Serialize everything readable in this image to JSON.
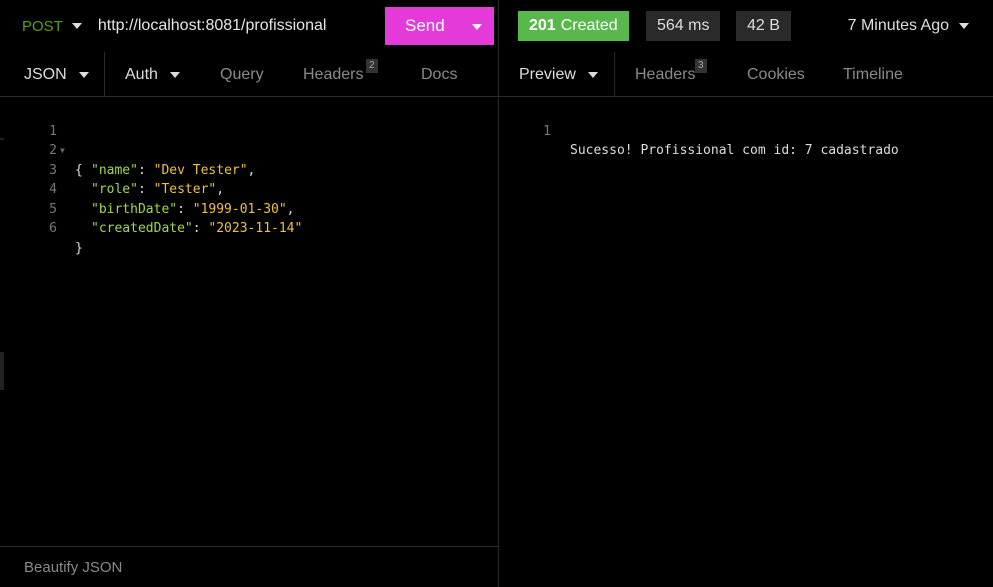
{
  "request": {
    "method": "POST",
    "url": "http://localhost:8081/profissional",
    "send_label": "Send"
  },
  "response": {
    "status_code": "201",
    "status_text": "Created",
    "time": "564 ms",
    "size": "42 B",
    "time_ago": "7 Minutes Ago"
  },
  "request_tabs": [
    {
      "label": "JSON"
    },
    {
      "label": "Auth"
    },
    {
      "label": "Query"
    },
    {
      "label": "Headers",
      "badge": "2"
    },
    {
      "label": "Docs"
    }
  ],
  "response_tabs": [
    {
      "label": "Preview"
    },
    {
      "label": "Headers",
      "badge": "3"
    },
    {
      "label": "Cookies"
    },
    {
      "label": "Timeline"
    }
  ],
  "body_lines": [
    {
      "n": "1",
      "fold": true
    },
    {
      "n": "2",
      "key": "\"name\"",
      "value": "\"Dev Tester\""
    },
    {
      "n": "3",
      "key": "\"role\"",
      "value": "\"Tester\""
    },
    {
      "n": "4",
      "key": "\"birthDate\"",
      "value": "\"1999-01-30\""
    },
    {
      "n": "5",
      "key": "\"createdDate\"",
      "value": "\"2023-11-14\""
    },
    {
      "n": "6"
    }
  ],
  "body_punct": {
    "open": "{",
    "close": "}",
    "colon": ": ",
    "comma": ","
  },
  "preview_lines": [
    {
      "n": "1",
      "text": "Sucesso! Profissional com id: 7 cadastrado"
    }
  ],
  "footer": {
    "beautify_label": "Beautify JSON"
  },
  "colors": {
    "method": "#59a210",
    "send": "#e43ad9",
    "status_ok": "#59b84b",
    "json_key": "#9fd84c",
    "json_string": "#f0c040"
  }
}
